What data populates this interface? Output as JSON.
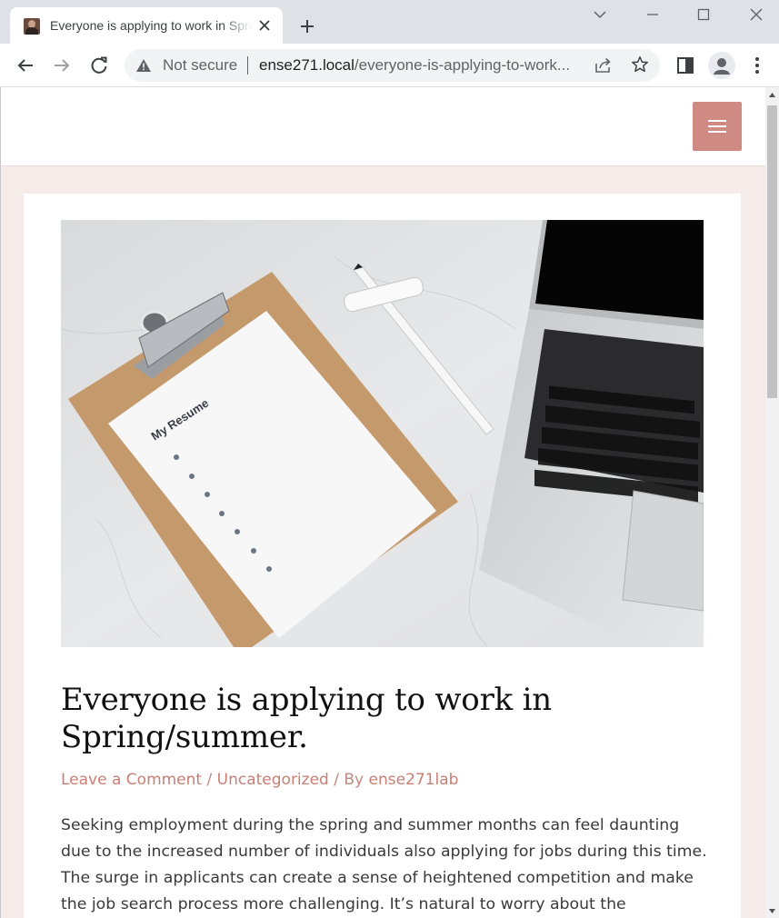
{
  "browser": {
    "tab_title": "Everyone is applying to work in Spring/summer.",
    "security_label": "Not secure",
    "url_host": "ense271.local",
    "url_path": "/everyone-is-applying-to-work..."
  },
  "site": {
    "menu_label": "Menu"
  },
  "post": {
    "image_text": "My Resume",
    "title": "Everyone is applying to work in Spring/summer.",
    "meta": {
      "comment_link": "Leave a Comment",
      "sep1": " / ",
      "category": "Uncategorized",
      "sep2": " / By ",
      "author": "ense271lab"
    },
    "body": "Seeking employment during the spring and summer months can feel daunting due to the increased number of individuals also applying for jobs during this time. The surge in applicants can create a sense of heightened competition and make the job search process more challenging. It’s natural to worry about the"
  },
  "colors": {
    "accent": "#d08a84",
    "link": "#c97e74",
    "page_background": "#f5ecea"
  },
  "icons": {
    "tab_close": "close-icon",
    "new_tab": "plus-icon",
    "back": "back-arrow-icon",
    "forward": "forward-arrow-icon",
    "reload": "reload-icon",
    "security": "warning-triangle-icon",
    "share": "share-icon",
    "bookmark": "star-icon",
    "side_panel": "side-panel-icon",
    "profile": "profile-avatar-icon",
    "menu": "kebab-menu-icon"
  }
}
